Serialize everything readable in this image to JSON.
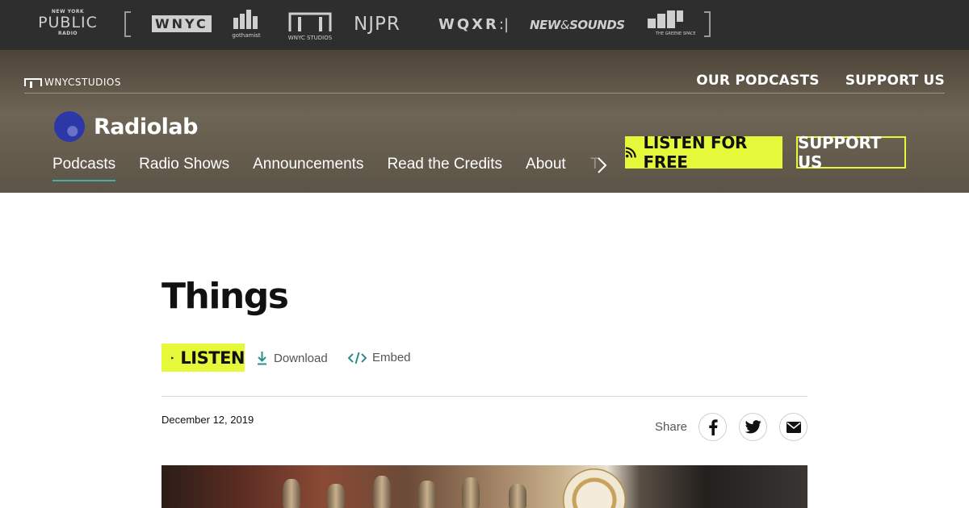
{
  "network_bar": {
    "brands": [
      {
        "top": "NEW YORK",
        "main": "PUBLIC",
        "bottom": "RADIO"
      },
      {
        "main": "WNYC"
      },
      {
        "main": "gothamist"
      },
      {
        "main": "WNYC STUDIOS"
      },
      {
        "main": "NJPR"
      },
      {
        "main": "WQXR"
      },
      {
        "main": "NEW SOUNDS",
        "part1": "NEW",
        "part2": "SOUNDS"
      },
      {
        "main": "THE GREENE SPACE"
      }
    ]
  },
  "header": {
    "studios_logo": "WNYCSTUDIOS",
    "links": [
      "OUR PODCASTS",
      "SUPPORT US"
    ],
    "show_title": "Radiolab",
    "nav": [
      "Podcasts",
      "Radio Shows",
      "Announcements",
      "Read the Credits",
      "About"
    ],
    "nav_overflow": "T",
    "active_nav": "Podcasts",
    "listen_free": "LISTEN FOR FREE",
    "support_us": "SUPPORT US"
  },
  "episode": {
    "title": "Things",
    "listen": "LISTEN",
    "download": "Download",
    "embed": "Embed",
    "date": "December 12, 2019",
    "share_label": "Share"
  },
  "colors": {
    "accent_yellow": "#e5f93a",
    "teal": "#3fb0ad",
    "network_bar": "#2e2e2e"
  }
}
